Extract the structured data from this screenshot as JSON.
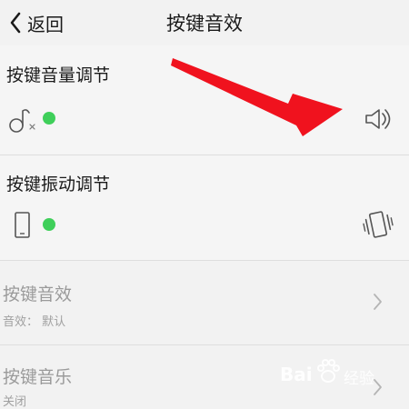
{
  "header": {
    "back_label": "返回",
    "title": "按键音效"
  },
  "volume_section": {
    "title": "按键音量调节",
    "left_icon": "muted-note-icon",
    "right_icon": "speaker-icon",
    "toggle_color": "#3fcf5a"
  },
  "vibration_section": {
    "title": "按键振动调节",
    "left_icon": "phone-icon",
    "right_icon": "vibrate-icon",
    "toggle_color": "#3fcf5a"
  },
  "sound_row": {
    "title": "按键音效",
    "subtitle": "音效：  默认"
  },
  "music_row": {
    "title": "按键音乐",
    "subtitle": "关闭"
  },
  "annotation": {
    "arrow_color": "#f0121e"
  },
  "watermark": {
    "brand": "Bai",
    "brand_suffix": "经验"
  }
}
